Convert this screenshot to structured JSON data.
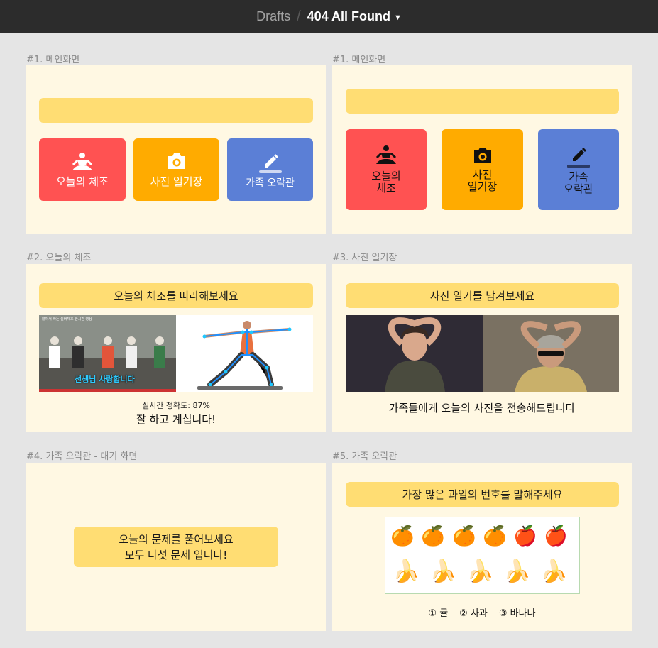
{
  "topbar": {
    "drafts": "Drafts",
    "separator": "/",
    "file_name": "404 All Found",
    "chevron": "⌄"
  },
  "frames": {
    "f1": {
      "label": "#1. 메인화면",
      "tiles": [
        "오늘의 체조",
        "사진 일기장",
        "가족 오락관"
      ]
    },
    "f1b": {
      "label": "#1. 메인화면",
      "tiles": [
        "오늘의\n체조",
        "사진\n일기장",
        "가족\n오락관"
      ]
    },
    "f2": {
      "label": "#2. 오늘의 체조",
      "banner": "오늘의 체조를 따라해보세요",
      "video_title": "앉아서 하는 실버체조 한시간 영상",
      "video_caption": "선생님 사랑합니다",
      "accuracy": "실시간 정확도: 87%",
      "feedback": "잘 하고 계십니다!"
    },
    "f3": {
      "label": "#3. 사진 일기장",
      "banner": "사진 일기를 남겨보세요",
      "caption": "가족들에게 오늘의 사진을 전송해드립니다"
    },
    "f4": {
      "label": "#4. 가족 오락관 - 대기 화면",
      "message_line1": "오늘의 문제를 풀어보세요",
      "message_line2": "모두 다섯 문제 입니다!"
    },
    "f5": {
      "label": "#5. 가족 오락관",
      "banner": "가장 많은 과일의 번호를 말해주세요",
      "fruits_row1": [
        "🍊",
        "🍊",
        "🍊",
        "🍊",
        "🍎",
        "🍎"
      ],
      "fruits_row2": [
        "🍌",
        "🍌",
        "🍌",
        "🍌",
        "🍌"
      ],
      "options": [
        "① 귤",
        "② 사과",
        "③ 바나나"
      ]
    }
  },
  "colors": {
    "red": "#ff5252",
    "orange": "#ffab00",
    "blue": "#5b7fd6",
    "yellow": "#ffdd73",
    "frame_bg": "#fff8e3",
    "canvas_bg": "#e5e5e5"
  }
}
